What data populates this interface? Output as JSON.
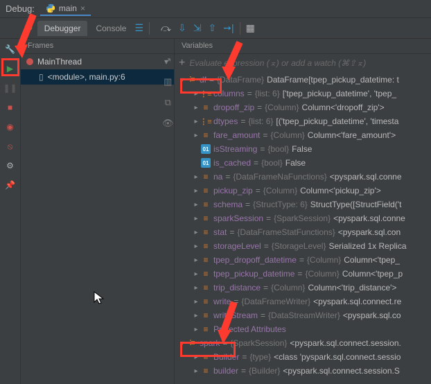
{
  "topbar": {
    "title": "Debug:",
    "file_icon": "python",
    "file_name": "main"
  },
  "tabs": {
    "rerun": "↻",
    "debugger": "Debugger",
    "console": "Console"
  },
  "panels": {
    "frames": "Frames",
    "variables": "Variables"
  },
  "thread": {
    "name": "MainThread"
  },
  "frame": {
    "label": "<module>, main.py:6"
  },
  "eval_placeholder": "Evaluate expression (⌅) or add a watch (⌘⇧⌅)",
  "tree": [
    {
      "depth": 0,
      "chev": "down",
      "icon": "struct",
      "name": "df",
      "eq": " = ",
      "type": "{DataFrame}",
      "val": " DataFrame[tpep_pickup_datetime: t"
    },
    {
      "depth": 1,
      "chev": "right",
      "icon": "list",
      "name": "columns",
      "eq": " = ",
      "type": "{list: 6}",
      "val": " ['tpep_pickup_datetime', 'tpep_"
    },
    {
      "depth": 1,
      "chev": "right",
      "icon": "field",
      "name": "dropoff_zip",
      "eq": " = ",
      "type": "{Column}",
      "val": " Column<'dropoff_zip'>"
    },
    {
      "depth": 1,
      "chev": "right",
      "icon": "list",
      "name": "dtypes",
      "eq": " = ",
      "type": "{list: 6}",
      "val": " [('tpep_pickup_datetime', 'timesta"
    },
    {
      "depth": 1,
      "chev": "right",
      "icon": "field",
      "name": "fare_amount",
      "eq": " = ",
      "type": "{Column}",
      "val": " Column<'fare_amount'>"
    },
    {
      "depth": 1,
      "chev": "none",
      "icon": "bool",
      "name": "isStreaming",
      "eq": " = ",
      "type": "{bool}",
      "val": " False"
    },
    {
      "depth": 1,
      "chev": "none",
      "icon": "bool",
      "name": "is_cached",
      "eq": " = ",
      "type": "{bool}",
      "val": " False"
    },
    {
      "depth": 1,
      "chev": "right",
      "icon": "field",
      "name": "na",
      "eq": " = ",
      "type": "{DataFrameNaFunctions}",
      "val": " <pyspark.sql.conne"
    },
    {
      "depth": 1,
      "chev": "right",
      "icon": "field",
      "name": "pickup_zip",
      "eq": " = ",
      "type": "{Column}",
      "val": " Column<'pickup_zip'>"
    },
    {
      "depth": 1,
      "chev": "right",
      "icon": "field",
      "name": "schema",
      "eq": " = ",
      "type": "{StructType: 6}",
      "val": " StructType([StructField('t"
    },
    {
      "depth": 1,
      "chev": "right",
      "icon": "field",
      "name": "sparkSession",
      "eq": " = ",
      "type": "{SparkSession}",
      "val": " <pyspark.sql.conne"
    },
    {
      "depth": 1,
      "chev": "right",
      "icon": "field",
      "name": "stat",
      "eq": " = ",
      "type": "{DataFrameStatFunctions}",
      "val": " <pyspark.sql.con"
    },
    {
      "depth": 1,
      "chev": "right",
      "icon": "field",
      "name": "storageLevel",
      "eq": " = ",
      "type": "{StorageLevel}",
      "val": " Serialized 1x Replica"
    },
    {
      "depth": 1,
      "chev": "right",
      "icon": "field",
      "name": "tpep_dropoff_datetime",
      "eq": " = ",
      "type": "{Column}",
      "val": " Column<'tpep_"
    },
    {
      "depth": 1,
      "chev": "right",
      "icon": "field",
      "name": "tpep_pickup_datetime",
      "eq": " = ",
      "type": "{Column}",
      "val": " Column<'tpep_p"
    },
    {
      "depth": 1,
      "chev": "right",
      "icon": "field",
      "name": "trip_distance",
      "eq": " = ",
      "type": "{Column}",
      "val": " Column<'trip_distance'>"
    },
    {
      "depth": 1,
      "chev": "right",
      "icon": "field",
      "name": "write",
      "eq": " = ",
      "type": "{DataFrameWriter}",
      "val": " <pyspark.sql.connect.re"
    },
    {
      "depth": 1,
      "chev": "right",
      "icon": "field",
      "name": "writeStream",
      "eq": " = ",
      "type": "{DataStreamWriter}",
      "val": " <pyspark.sql.co"
    },
    {
      "depth": 1,
      "chev": "right",
      "icon": "field",
      "name": "Protected Attributes",
      "eq": "",
      "type": "",
      "val": ""
    },
    {
      "depth": 0,
      "chev": "down",
      "icon": "struct",
      "name": "spark",
      "eq": " = ",
      "type": "{SparkSession}",
      "val": " <pyspark.sql.connect.session."
    },
    {
      "depth": 1,
      "chev": "right",
      "icon": "field",
      "name": "Builder",
      "eq": " = ",
      "type": "{type}",
      "val": " <class 'pyspark.sql.connect.sessio"
    },
    {
      "depth": 1,
      "chev": "right",
      "icon": "field",
      "name": "builder",
      "eq": " = ",
      "type": "{Builder}",
      "val": " <pyspark.sql.connect.session.S"
    }
  ]
}
